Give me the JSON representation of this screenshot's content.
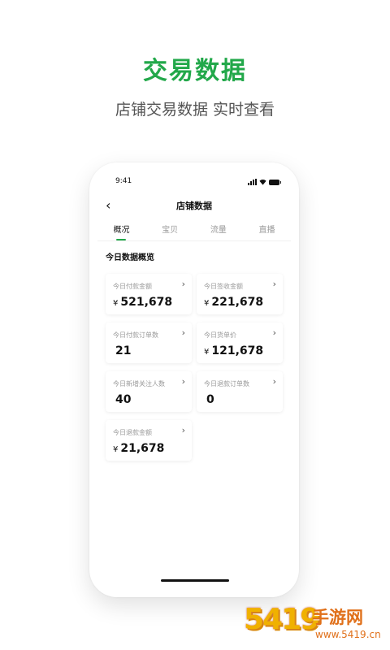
{
  "headline": "交易数据",
  "subheadline": "店铺交易数据 实时查看",
  "status_bar": {
    "time": "9:41"
  },
  "nav": {
    "back_icon": "chevron-left-icon",
    "title": "店铺数据"
  },
  "tabs": [
    {
      "label": "概况",
      "active": true
    },
    {
      "label": "宝贝",
      "active": false
    },
    {
      "label": "流量",
      "active": false
    },
    {
      "label": "直播",
      "active": false
    }
  ],
  "section_title": "今日数据概览",
  "cards": [
    {
      "label": "今日付款金额",
      "currency": "¥",
      "value": "521,678"
    },
    {
      "label": "今日签收金额",
      "currency": "¥",
      "value": "221,678"
    },
    {
      "label": "今日付款订单数",
      "currency": "",
      "value": "21"
    },
    {
      "label": "今日货单价",
      "currency": "¥",
      "value": "121,678"
    },
    {
      "label": "今日新增关注人数",
      "currency": "",
      "value": "40"
    },
    {
      "label": "今日退款订单数",
      "currency": "",
      "value": "0"
    },
    {
      "label": "今日退款金额",
      "currency": "¥",
      "value": "21,678"
    }
  ],
  "watermark": {
    "digits": "5419",
    "text": "手游网",
    "url": "www.5419.cn"
  },
  "colors": {
    "accent": "#22a84a",
    "watermark": "#e0701a"
  }
}
